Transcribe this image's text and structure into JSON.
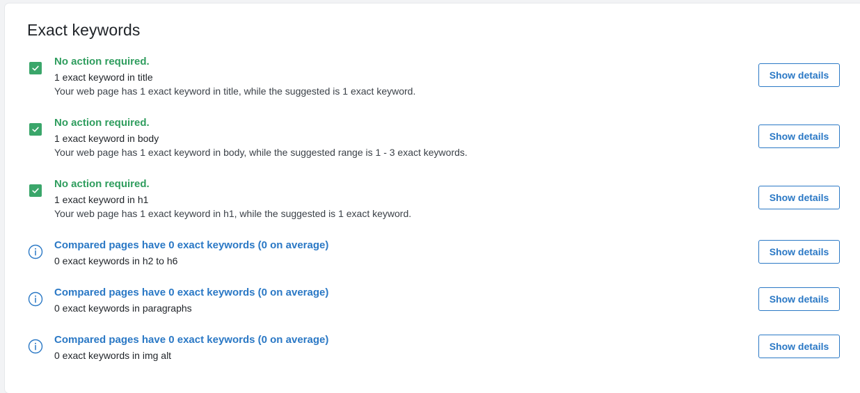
{
  "section": {
    "title": "Exact keywords"
  },
  "rows": [
    {
      "status": "ok",
      "headline": "No action required.",
      "subline": "1 exact keyword in title",
      "description": "Your web page has 1 exact keyword in title, while the suggested is 1 exact keyword.",
      "button": "Show details",
      "icon": "check-icon"
    },
    {
      "status": "ok",
      "headline": "No action required.",
      "subline": "1 exact keyword in body",
      "description": "Your web page has 1 exact keyword in body, while the suggested range is 1 - 3 exact keywords.",
      "button": "Show details",
      "icon": "check-icon"
    },
    {
      "status": "ok",
      "headline": "No action required.",
      "subline": "1 exact keyword in h1",
      "description": "Your web page has 1 exact keyword in h1, while the suggested is 1 exact keyword.",
      "button": "Show details",
      "icon": "check-icon"
    },
    {
      "status": "info",
      "headline": "Compared pages have 0 exact keywords (0 on average)",
      "subline": "0 exact keywords in h2 to h6",
      "button": "Show details",
      "icon": "info-icon"
    },
    {
      "status": "info",
      "headline": "Compared pages have 0 exact keywords (0 on average)",
      "subline": "0 exact keywords in paragraphs",
      "button": "Show details",
      "icon": "info-icon"
    },
    {
      "status": "info",
      "headline": "Compared pages have 0 exact keywords (0 on average)",
      "subline": "0 exact keywords in img alt",
      "button": "Show details",
      "icon": "info-icon"
    }
  ],
  "colors": {
    "ok": "#2f9d5e",
    "check_fill": "#3aa66a",
    "info": "#2a78c5",
    "text": "#1f2328"
  }
}
